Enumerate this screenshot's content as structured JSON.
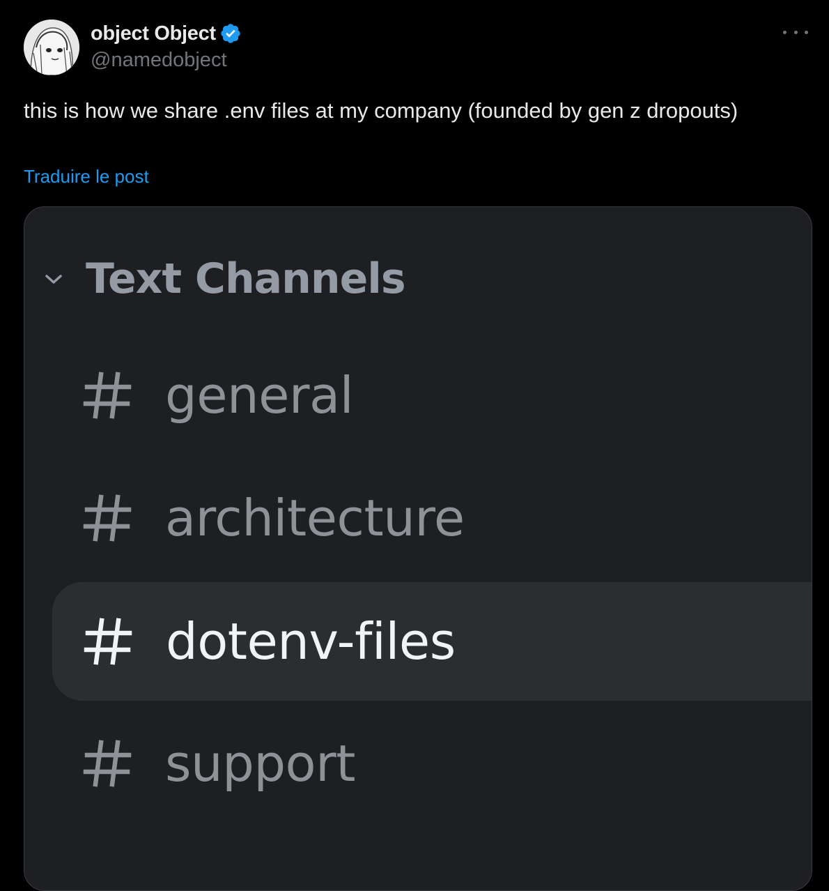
{
  "author": {
    "display_name": "object Object",
    "handle": "@namedobject",
    "verified": true,
    "verified_color": "#1d9bf0"
  },
  "tweet": {
    "text": "this is how we share .env files at my company (founded by gen z dropouts)",
    "translate_label": "Traduire le post"
  },
  "icons": {
    "more": "more-options-icon",
    "verified": "verified-badge-icon",
    "chevron": "chevron-down-icon",
    "hash": "hashtag-icon"
  },
  "media": {
    "category_label": "Text Channels",
    "channels": [
      {
        "name": "general",
        "active": false
      },
      {
        "name": "architecture",
        "active": false
      },
      {
        "name": "dotenv-files",
        "active": true
      },
      {
        "name": "support",
        "active": false
      }
    ],
    "colors": {
      "background": "#1e1f22",
      "active_background": "#2b2d31",
      "muted_text": "#949ba4",
      "active_text": "#f2f3f5"
    }
  }
}
